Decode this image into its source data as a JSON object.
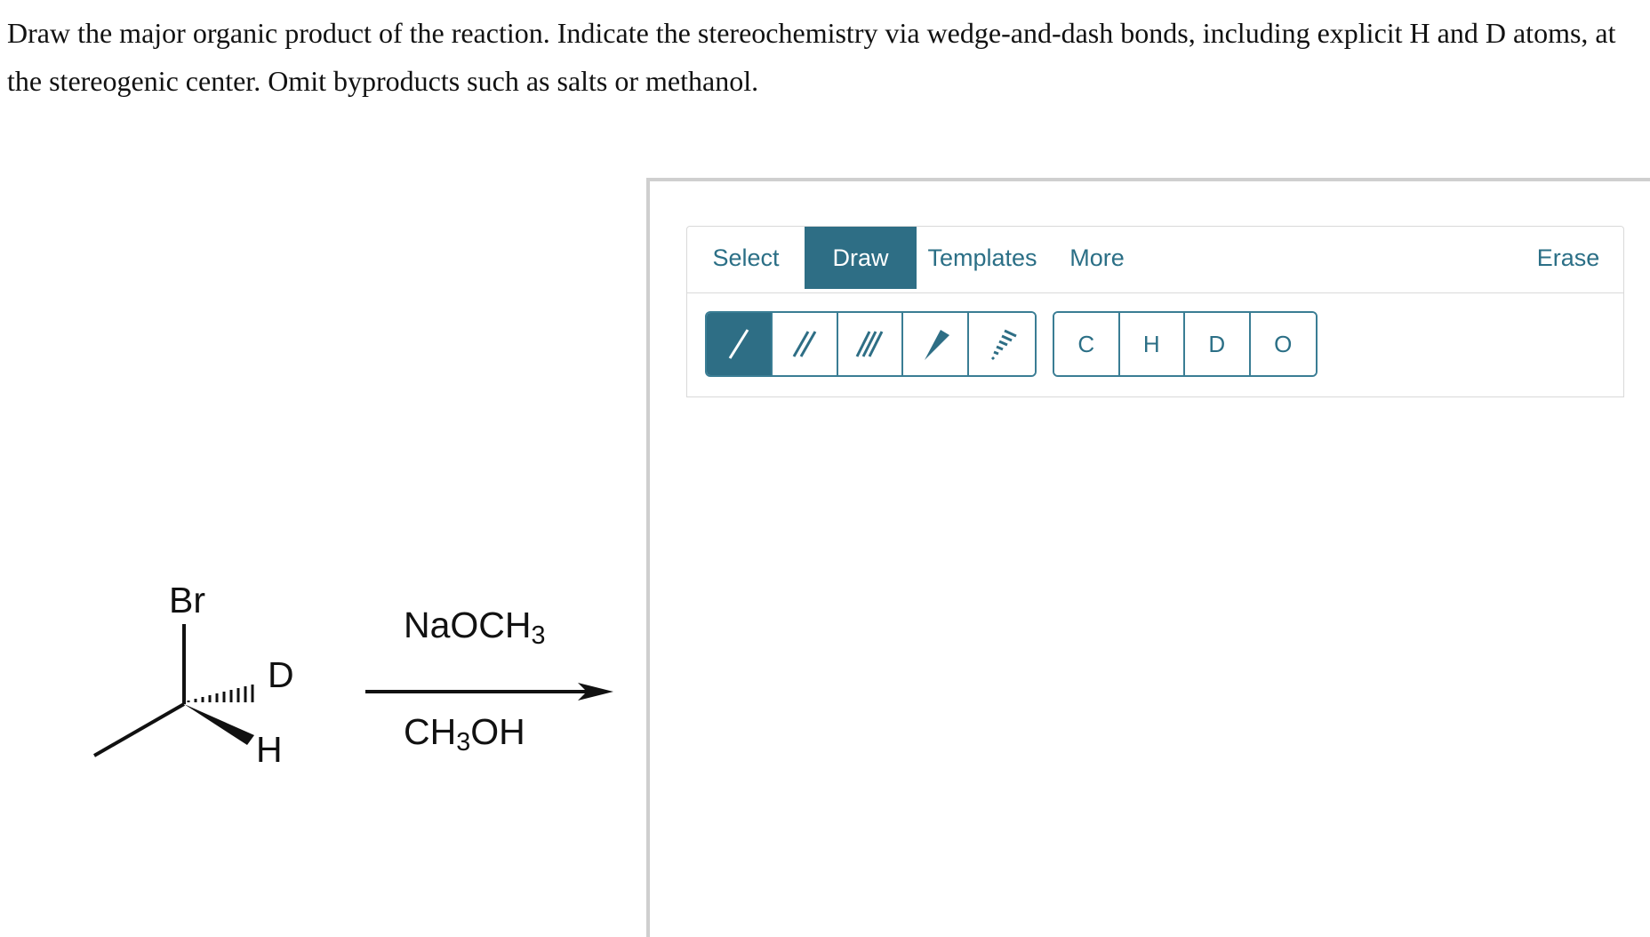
{
  "question": {
    "text": "Draw the major organic product of the reaction. Indicate the stereochemistry via wedge-and-dash bonds, including explicit H and D atoms, at the stereogenic center. Omit byproducts such as salts or methanol."
  },
  "reaction": {
    "reactant_atoms": {
      "br": "Br",
      "d": "D",
      "h": "H"
    },
    "reagent_top": {
      "text": "NaOCH",
      "sub": "3"
    },
    "solvent_bottom": {
      "text_a": "CH",
      "sub": "3",
      "text_b": "OH"
    }
  },
  "editor": {
    "tabs": [
      {
        "label": "Select",
        "active": false
      },
      {
        "label": "Draw",
        "active": true
      },
      {
        "label": "Templates",
        "active": false
      },
      {
        "label": "More",
        "active": false
      }
    ],
    "erase_label": "Erase",
    "bond_tools": [
      {
        "name": "single-bond",
        "active": true
      },
      {
        "name": "double-bond",
        "active": false
      },
      {
        "name": "triple-bond",
        "active": false
      },
      {
        "name": "wedge-bond",
        "active": false
      },
      {
        "name": "dash-bond",
        "active": false
      }
    ],
    "atom_tools": [
      "C",
      "H",
      "D",
      "O"
    ],
    "accent_color": "#2e6e85"
  }
}
